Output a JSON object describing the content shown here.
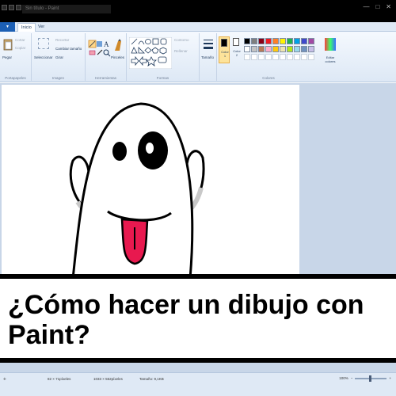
{
  "window": {
    "title": "Sin título - Paint",
    "minimize": "—",
    "maximize": "□",
    "close": "✕"
  },
  "tabs": {
    "file": "▾",
    "home": "Inicio",
    "view": "Ver"
  },
  "ribbon": {
    "clipboard": {
      "paste": "Pegar",
      "cut": "Cortar",
      "copy": "Copiar",
      "label": "Portapapeles"
    },
    "image": {
      "select": "Seleccionar",
      "crop": "Recortar",
      "resize": "Cambiar tamaño",
      "rotate": "Girar",
      "label": "Imagen"
    },
    "tools": {
      "brushes": "Pinceles",
      "label": "Herramientas"
    },
    "shapes": {
      "outline": "Contorno",
      "fill": "Rellenar",
      "label": "Formas"
    },
    "size": {
      "label": "Tamaño"
    },
    "colors": {
      "color1": "Color 1",
      "color2": "Color 2",
      "edit": "Editar colores",
      "label": "Colores",
      "color1_value": "#000000",
      "color2_value": "#ffffff",
      "palette": [
        "#000000",
        "#7f7f7f",
        "#880015",
        "#ed1c24",
        "#ff7f27",
        "#fff200",
        "#22b14c",
        "#00a2e8",
        "#3f48cc",
        "#a349a4",
        "#ffffff",
        "#c3c3c3",
        "#b97a57",
        "#ffaec9",
        "#ffc90e",
        "#efe4b0",
        "#b5e61d",
        "#99d9ea",
        "#7092be",
        "#c8bfe7"
      ]
    }
  },
  "caption": {
    "text": "¿Cómo hacer un dibujo con Paint?"
  },
  "status": {
    "cursor": "82 × 71píxeles",
    "selection": "",
    "canvas_size": "1033 × 552píxeles",
    "file_size": "Tamaño: 9,1KB",
    "zoom": "100%"
  }
}
